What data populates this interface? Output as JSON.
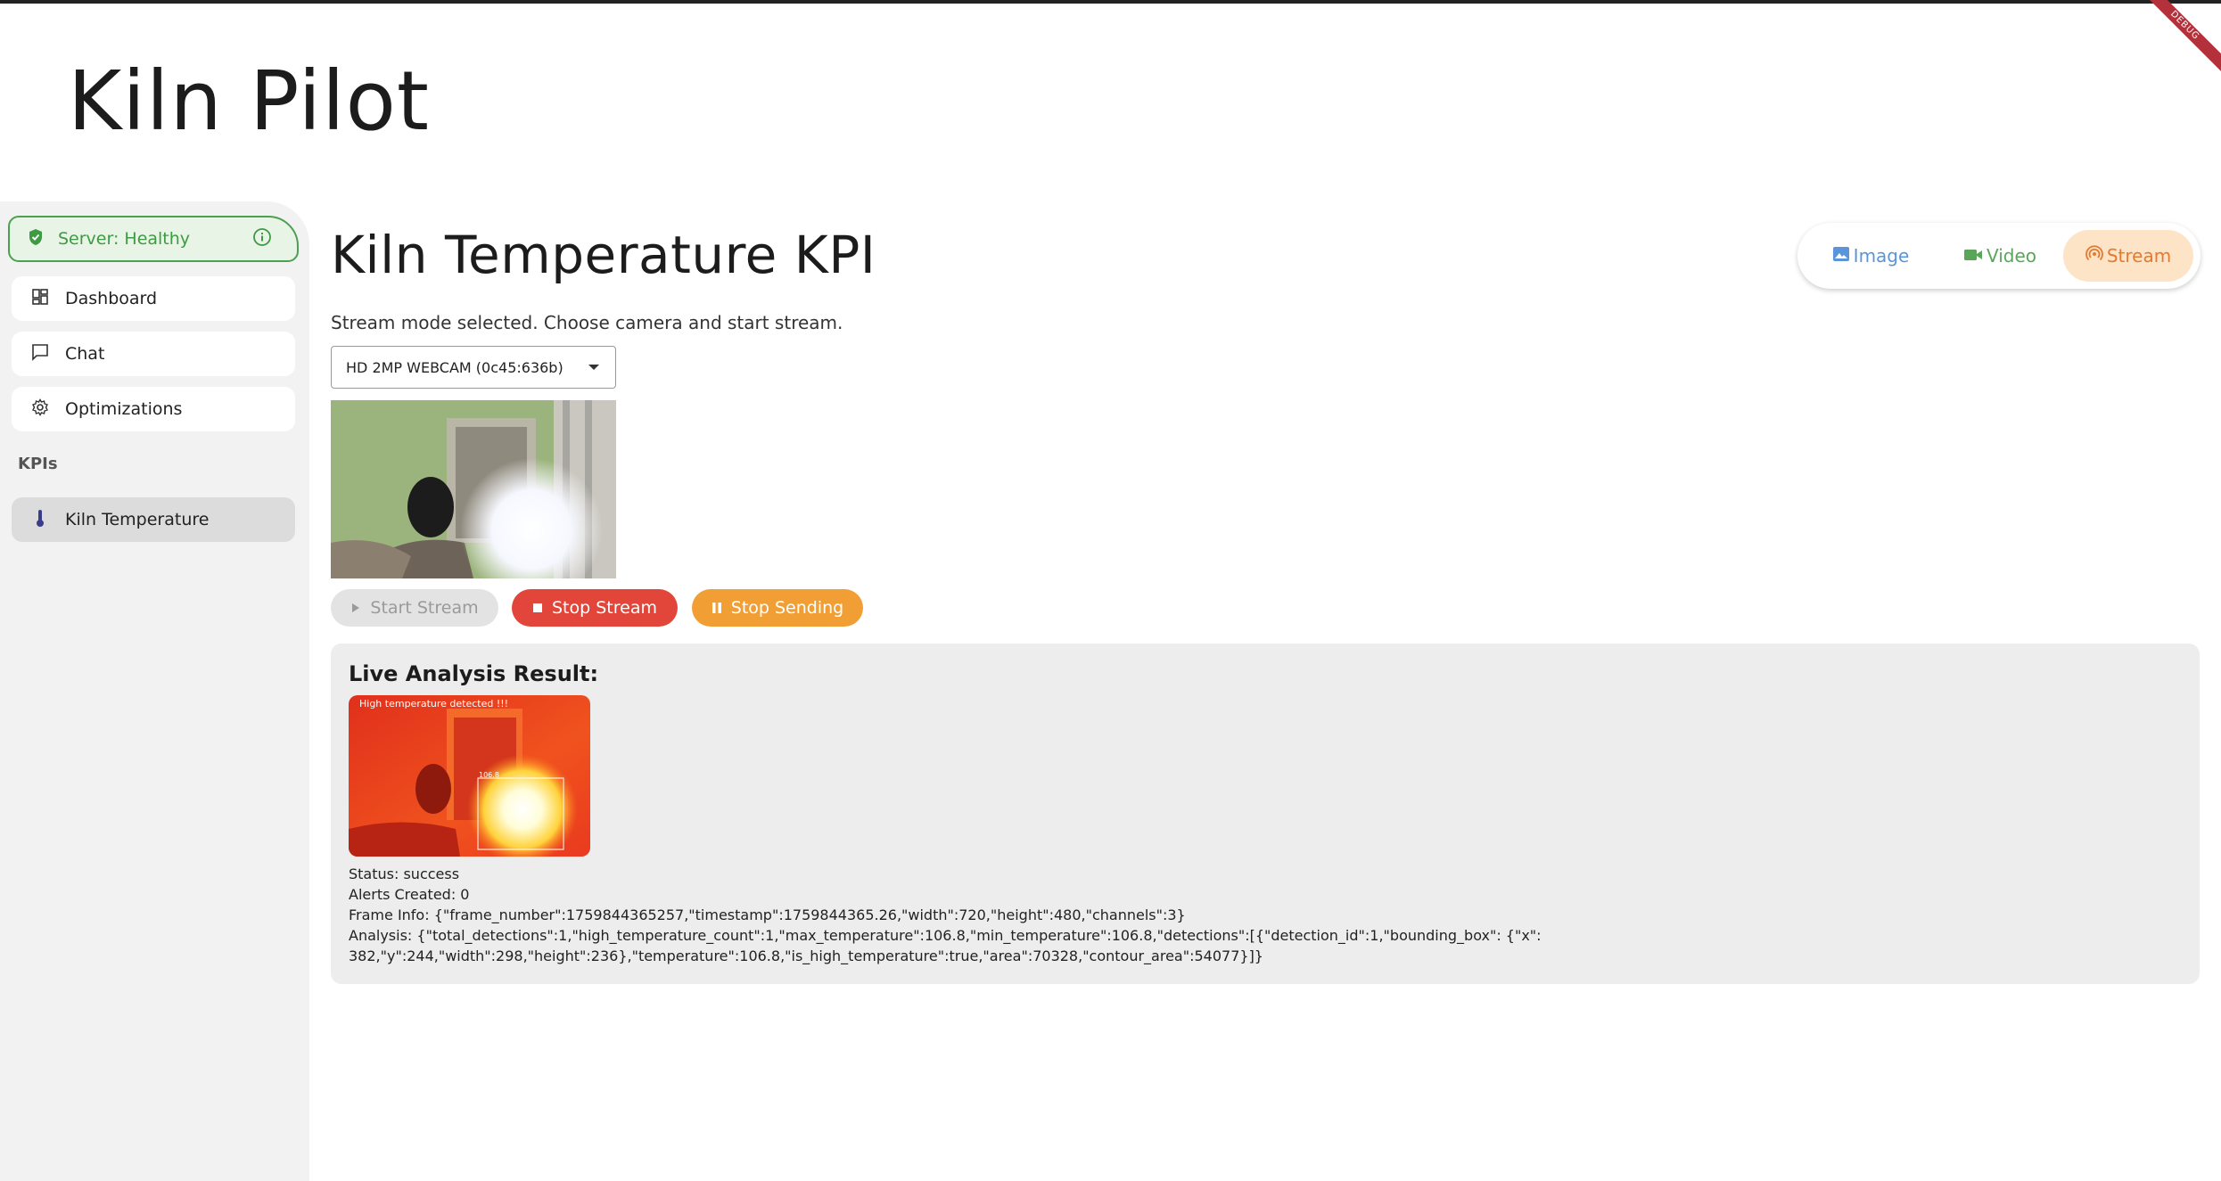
{
  "app": {
    "title": "Kiln Pilot",
    "badge": "DEBUG"
  },
  "sidebar": {
    "server_status": "Server: Healthy",
    "items": [
      {
        "label": "Dashboard",
        "icon": "dashboard-icon"
      },
      {
        "label": "Chat",
        "icon": "chat-icon"
      },
      {
        "label": "Optimizations",
        "icon": "gear-icon"
      }
    ],
    "kpis_header": "KPIs",
    "kpi_items": [
      {
        "label": "Kiln Temperature",
        "icon": "thermometer-icon",
        "active": true
      }
    ]
  },
  "main": {
    "title": "Kiln Temperature KPI",
    "mode_message": "Stream mode selected. Choose camera and start stream.",
    "modes": [
      {
        "label": "Image",
        "icon": "image-icon",
        "color": "#5b95d9"
      },
      {
        "label": "Video",
        "icon": "videocam-icon",
        "color": "#5ba55b"
      },
      {
        "label": "Stream",
        "icon": "stream-icon",
        "color": "#e37a32",
        "selected": true
      }
    ],
    "camera": {
      "selected": "HD 2MP WEBCAM (0c45:636b)"
    },
    "buttons": {
      "start": "Start Stream",
      "stop": "Stop Stream",
      "pause": "Stop Sending"
    },
    "result": {
      "title": "Live Analysis Result:",
      "overlay_text": "High temperature detected !!!",
      "box_label": "106.8",
      "status": "Status: success",
      "alerts": "Alerts Created: 0",
      "frame_info": "Frame Info: {\"frame_number\":1759844365257,\"timestamp\":1759844365.26,\"width\":720,\"height\":480,\"channels\":3}",
      "analysis": "Analysis: {\"total_detections\":1,\"high_temperature_count\":1,\"max_temperature\":106.8,\"min_temperature\":106.8,\"detections\":[{\"detection_id\":1,\"bounding_box\": {\"x\":382,\"y\":244,\"width\":298,\"height\":236},\"temperature\":106.8,\"is_high_temperature\":true,\"area\":70328,\"contour_area\":54077}]}"
    }
  },
  "colors": {
    "accent_stream": "#e37a32",
    "stop": "#e2463a",
    "pause": "#f19f34",
    "healthy": "#3e9a43"
  }
}
